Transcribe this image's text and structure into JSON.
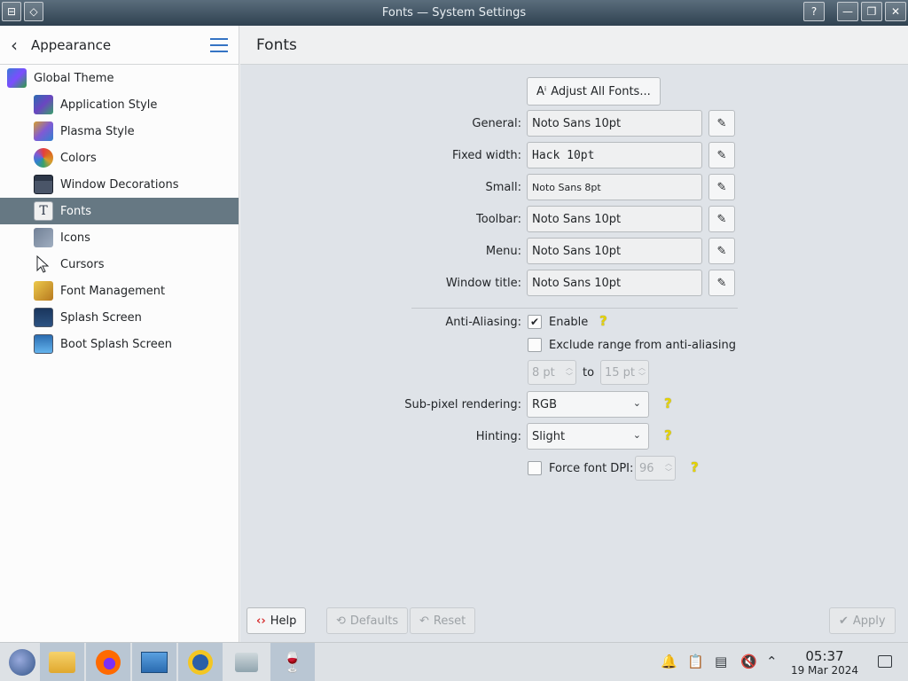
{
  "window": {
    "title": "Fonts — System Settings",
    "help_btn": "?"
  },
  "sidebar": {
    "back_label": "Appearance",
    "items": [
      {
        "label": "Global Theme",
        "level": "top"
      },
      {
        "label": "Application Style",
        "level": "sub"
      },
      {
        "label": "Plasma Style",
        "level": "sub"
      },
      {
        "label": "Colors",
        "level": "sub"
      },
      {
        "label": "Window Decorations",
        "level": "sub"
      },
      {
        "label": "Fonts",
        "level": "sub",
        "selected": true
      },
      {
        "label": "Icons",
        "level": "sub"
      },
      {
        "label": "Cursors",
        "level": "sub"
      },
      {
        "label": "Font Management",
        "level": "sub"
      },
      {
        "label": "Splash Screen",
        "level": "sub"
      },
      {
        "label": "Boot Splash Screen",
        "level": "sub"
      }
    ]
  },
  "main": {
    "title": "Fonts",
    "adjust_all": "Adjust All Fonts...",
    "fonts": [
      {
        "label": "General:",
        "value": "Noto Sans 10pt"
      },
      {
        "label": "Fixed width:",
        "value": "Hack 10pt"
      },
      {
        "label": "Small:",
        "value": "Noto Sans 8pt"
      },
      {
        "label": "Toolbar:",
        "value": "Noto Sans 10pt"
      },
      {
        "label": "Menu:",
        "value": "Noto Sans 10pt"
      },
      {
        "label": "Window title:",
        "value": "Noto Sans 10pt"
      }
    ],
    "antialiasing": {
      "label": "Anti-Aliasing:",
      "enable_label": "Enable",
      "enabled": true,
      "exclude_label": "Exclude range from anti-aliasing",
      "exclude_checked": false,
      "from": "8 pt",
      "to_label": "to",
      "to": "15 pt"
    },
    "subpixel": {
      "label": "Sub-pixel rendering:",
      "value": "RGB"
    },
    "hinting": {
      "label": "Hinting:",
      "value": "Slight"
    },
    "dpi": {
      "label": "Force font DPI:",
      "value": "96",
      "checked": false
    }
  },
  "bottom": {
    "help": "Help",
    "defaults": "Defaults",
    "reset": "Reset",
    "apply": "Apply"
  },
  "taskbar": {
    "time": "05:37",
    "date": "19 Mar 2024"
  },
  "colors": {
    "accent": "#3574c4",
    "selected_bg": "#667883",
    "help_yellow": "#e5d300"
  }
}
